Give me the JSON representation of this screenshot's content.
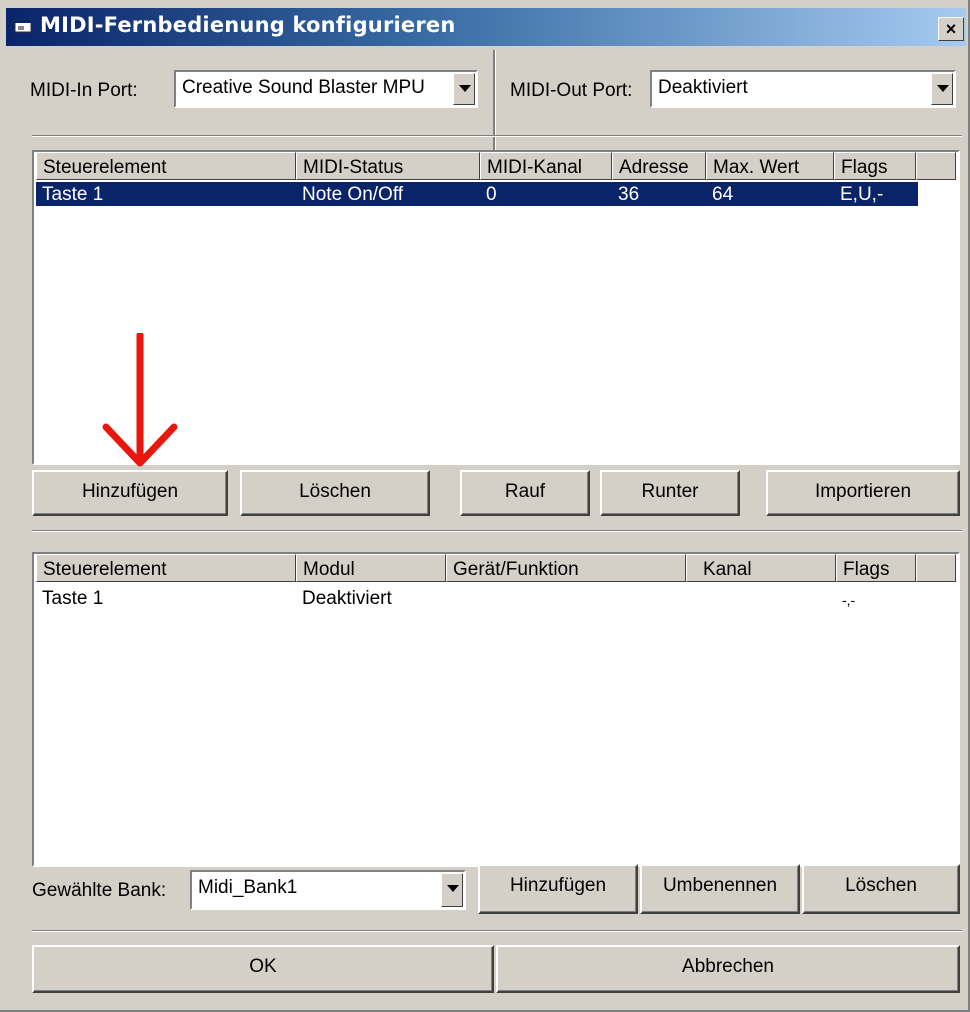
{
  "window": {
    "title": "MIDI-Fernbedienung konfigurieren",
    "close_label": "×"
  },
  "ports": {
    "midi_in_label": "MIDI-In Port:",
    "midi_in_value": "Creative Sound Blaster MPU",
    "midi_out_label": "MIDI-Out Port:",
    "midi_out_value": "Deaktiviert"
  },
  "midi_list": {
    "columns": [
      "Steuerelement",
      "MIDI-Status",
      "MIDI-Kanal",
      "Adresse",
      "Max. Wert",
      "Flags"
    ],
    "rows": [
      [
        "Taste 1",
        "Note On/Off",
        "0",
        "36",
        "64",
        "E,U,-"
      ]
    ]
  },
  "midi_buttons": {
    "add": "Hinzufügen",
    "delete": "Löschen",
    "up": "Rauf",
    "down": "Runter",
    "import": "Importieren"
  },
  "action_list": {
    "columns": [
      "Steuerelement",
      "Modul",
      "Gerät/Funktion",
      "Kanal",
      "Flags"
    ],
    "rows": [
      [
        "Taste 1",
        "Deaktiviert",
        "",
        "",
        "-,-"
      ]
    ]
  },
  "bank": {
    "label": "Gewählte Bank:",
    "value": "Midi_Bank1",
    "add": "Hinzufügen",
    "rename": "Umbenennen",
    "delete": "Löschen"
  },
  "footer": {
    "ok": "OK",
    "cancel": "Abbrechen"
  },
  "colors": {
    "dialog_bg": "#d4d0c8",
    "title_gradient_start": "#0a246a",
    "selection_bg": "#0a246a",
    "annotation_arrow": "#e8160c"
  },
  "icons": {
    "title_icon": "app-window-icon",
    "close": "close-icon",
    "dropdown": "chevron-down-icon",
    "annotation": "red-arrow-down-icon"
  }
}
